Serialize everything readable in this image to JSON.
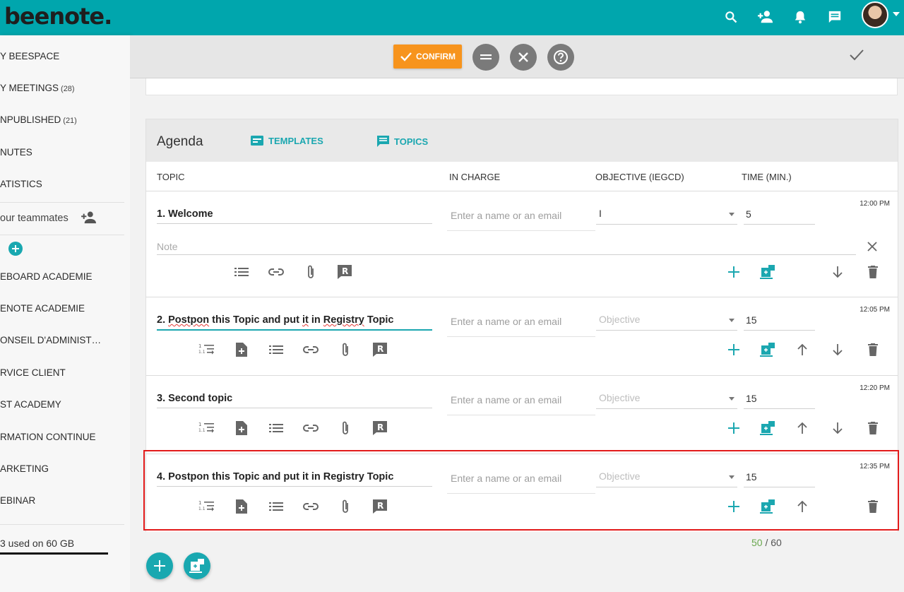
{
  "app": {
    "logo": "beenote."
  },
  "sidebar": {
    "items": [
      {
        "label": "Y BEESPACE",
        "count": ""
      },
      {
        "label": "Y MEETINGS",
        "count": "(28)"
      },
      {
        "label": "NPUBLISHED",
        "count": "(21)"
      },
      {
        "label": "NUTES",
        "count": ""
      },
      {
        "label": "ATISTICS",
        "count": ""
      },
      {
        "label": "our teammates",
        "count": ""
      },
      {
        "label": "EBOARD ACADEMIE",
        "count": ""
      },
      {
        "label": "ENOTE ACADEMIE",
        "count": ""
      },
      {
        "label": "ONSEIL D'ADMINISTRA...",
        "count": ""
      },
      {
        "label": "RVICE CLIENT",
        "count": ""
      },
      {
        "label": "ST ACADEMY",
        "count": ""
      },
      {
        "label": "RMATION CONTINUE",
        "count": ""
      },
      {
        "label": "ARKETING",
        "count": ""
      },
      {
        "label": "EBINAR",
        "count": ""
      }
    ],
    "storage": "3 used on 60 GB"
  },
  "actionbar": {
    "confirm_label": "CONFIRM"
  },
  "agenda": {
    "title": "Agenda",
    "templates_label": "TEMPLATES",
    "topics_label": "TOPICS",
    "columns": {
      "topic": "TOPIC",
      "in_charge": "IN CHARGE",
      "objective": "OBJECTIVE (IEGCD)",
      "time": "TIME (MIN.)"
    },
    "incharge_placeholder": "Enter a name or an email",
    "objective_placeholder": "Objective",
    "note_placeholder": "Note",
    "rows": [
      {
        "title_num": "1.",
        "title": "Welcome",
        "objective": "I",
        "time": "5",
        "clock": "12:00 PM"
      },
      {
        "title_num": "2.",
        "title_words": [
          "Postpon",
          "this Topic and put",
          "it",
          "in",
          "Registry",
          "Topic"
        ],
        "objective": "",
        "time": "15",
        "clock": "12:05 PM"
      },
      {
        "title_num": "3.",
        "title": "Second topic",
        "objective": "",
        "time": "15",
        "clock": "12:20 PM"
      },
      {
        "title_num": "4.",
        "title": "Postpon this Topic and put it in Registry Topic",
        "objective": "",
        "time": "15",
        "clock": "12:35 PM"
      }
    ]
  },
  "budget": {
    "used": "50",
    "total": "/ 60"
  },
  "colors": {
    "teal": "#00a6ad",
    "accent": "#1ba7b0",
    "confirm": "#f7941d",
    "highlight": "#e21b1b"
  }
}
